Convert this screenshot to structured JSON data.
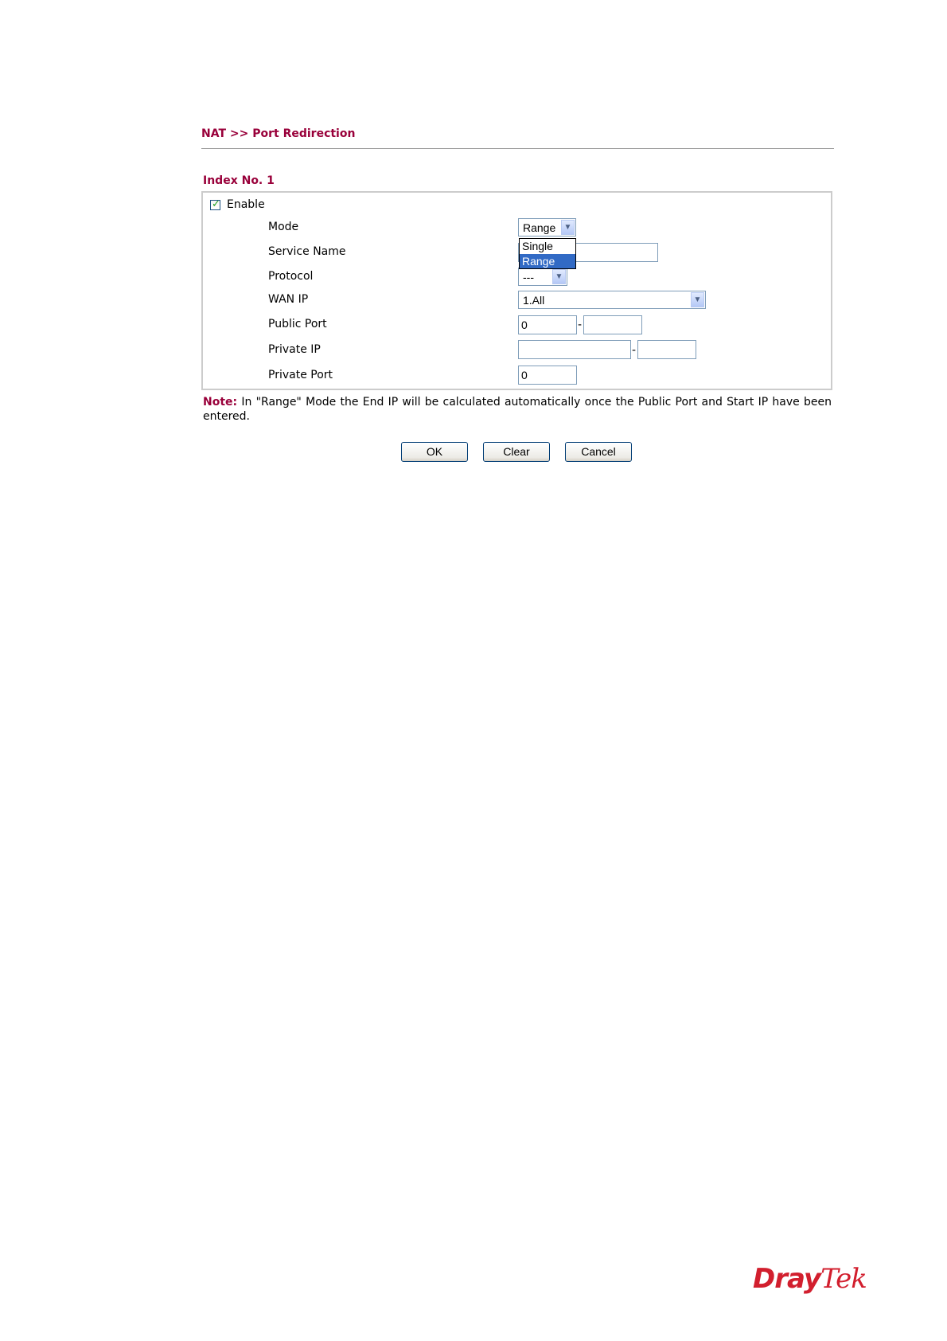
{
  "header": {
    "breadcrumb": "NAT >> Port Redirection"
  },
  "form": {
    "index_label": "Index No. 1",
    "enable_label": "Enable",
    "enable_checked": true,
    "fields": {
      "mode": {
        "label": "Mode",
        "value": "Range"
      },
      "service_name": {
        "label": "Service Name",
        "value": ""
      },
      "protocol": {
        "label": "Protocol",
        "value": "---"
      },
      "wan_ip": {
        "label": "WAN IP",
        "value": "1.All"
      },
      "public_port": {
        "label": "Public Port",
        "start": "0",
        "end": "",
        "separator": "-"
      },
      "private_ip": {
        "label": "Private IP",
        "start": "",
        "end": "",
        "separator": "-"
      },
      "private_port": {
        "label": "Private Port",
        "value": "0"
      }
    },
    "mode_dropdown_options": [
      "Single",
      "Range"
    ],
    "mode_dropdown_selected": "Range"
  },
  "note": {
    "prefix": "Note:",
    "text": " In \"Range\" Mode the End IP will be calculated automatically once the Public Port and Start IP have been entered."
  },
  "buttons": {
    "ok": "OK",
    "clear": "Clear",
    "cancel": "Cancel"
  },
  "branding": {
    "logo_part1": "Dray",
    "logo_part2": "Tek",
    "color": "#d21f2e"
  },
  "colors": {
    "accent": "#99003a",
    "select_highlight": "#316ac5"
  }
}
